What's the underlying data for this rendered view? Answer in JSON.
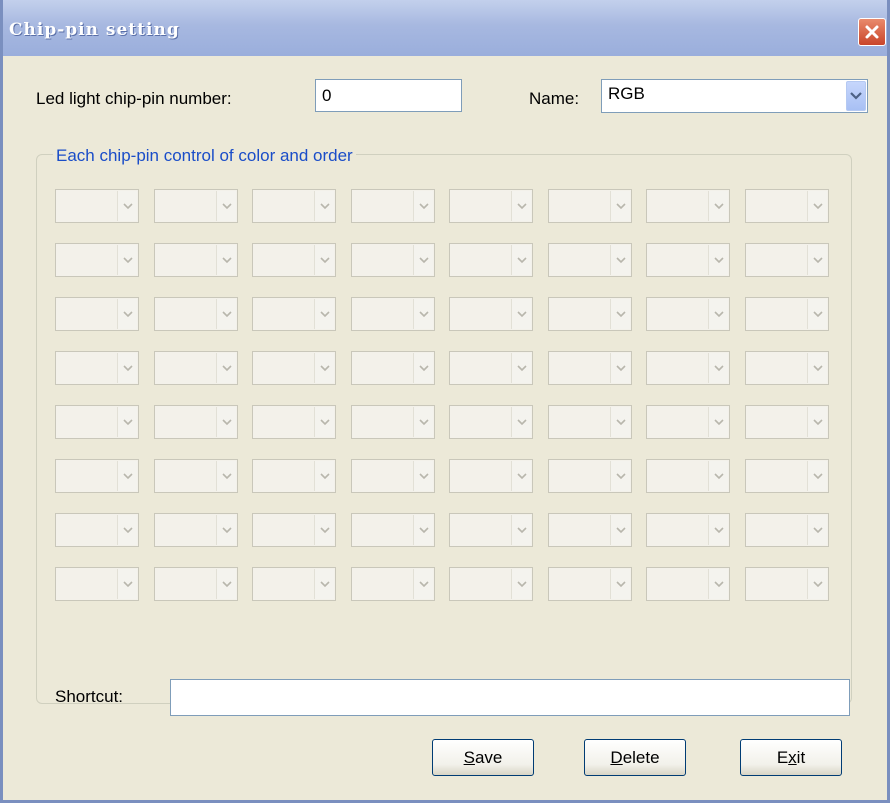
{
  "window": {
    "title": "Chip-pin setting"
  },
  "chip_pin_number": {
    "label": "Led light chip-pin number:",
    "value": "0"
  },
  "name": {
    "label": "Name:",
    "value": "RGB"
  },
  "group": {
    "title": "Each chip-pin control of color and order"
  },
  "grid": {
    "rows": 8,
    "cols": 8,
    "enabled": false
  },
  "shortcut": {
    "label": "Shortcut:",
    "value": ""
  },
  "buttons": {
    "save": {
      "pre": "",
      "accel": "S",
      "post": "ave"
    },
    "delete": {
      "pre": "",
      "accel": "D",
      "post": "elete"
    },
    "exit": {
      "pre": "E",
      "accel": "x",
      "post": "it"
    }
  },
  "colors": {
    "titlebar": "#A7B8E0",
    "face": "#ECE9D8",
    "group_title": "#1A4DC8",
    "close": "#C9452A"
  }
}
